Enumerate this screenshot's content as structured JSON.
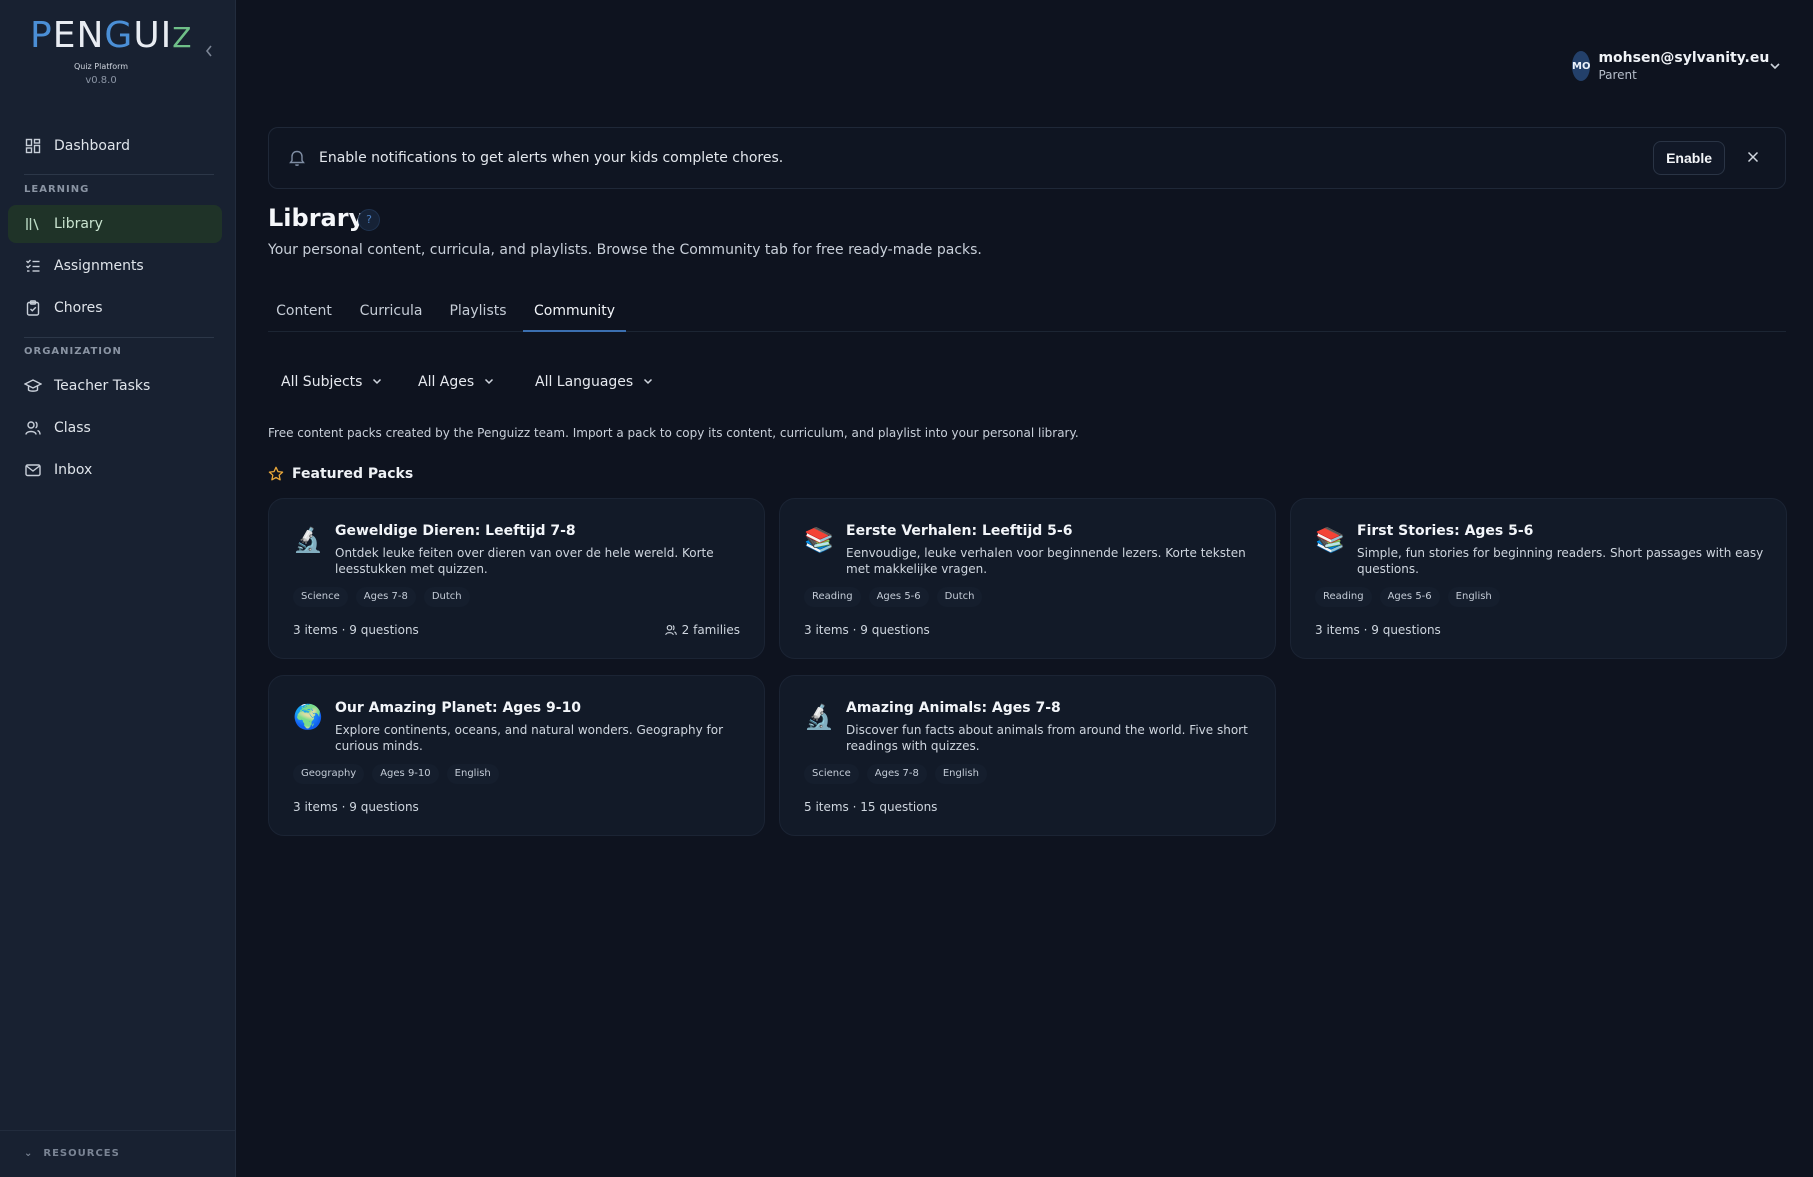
{
  "app": {
    "logo_text_p": "P",
    "logo_text_en": "EN",
    "logo_text_g": "G",
    "logo_text_ui": "UI",
    "logo_text_z": "Z",
    "subtitle": "Quiz Platform",
    "version": "v0.8.0"
  },
  "sidebar": {
    "dashboard": "Dashboard",
    "section_learning": "LEARNING",
    "library": "Library",
    "assignments": "Assignments",
    "chores": "Chores",
    "section_organization": "ORGANIZATION",
    "teacher_tasks": "Teacher Tasks",
    "class": "Class",
    "inbox": "Inbox",
    "resources": "RESOURCES"
  },
  "user": {
    "initials": "MO",
    "email": "mohsen@sylvanity.eu",
    "role": "Parent"
  },
  "banner": {
    "text": "Enable notifications to get alerts when your kids complete chores.",
    "enable_label": "Enable"
  },
  "header": {
    "title": "Library",
    "help": "?",
    "subtitle": "Your personal content, curricula, and playlists. Browse the Community tab for free ready-made packs."
  },
  "tabs": [
    "Content",
    "Curricula",
    "Playlists",
    "Community"
  ],
  "active_tab": "Community",
  "filters": {
    "subjects": "All Subjects",
    "ages": "All Ages",
    "languages": "All Languages"
  },
  "intro": "Free content packs created by the Penguizz team. Import a pack to copy its content, curriculum, and playlist into your personal library.",
  "featured_label": "Featured Packs",
  "packs": [
    {
      "icon": "microscope-icon",
      "emoji": "🔬",
      "title": "Geweldige Dieren: Leeftijd 7-8",
      "desc": "Ontdek leuke feiten over dieren van over de hele wereld. Korte leesstukken met quizzen.",
      "tags": [
        "Science",
        "Ages 7-8",
        "Dutch"
      ],
      "meta": "3 items · 9 questions",
      "families": "2 families"
    },
    {
      "icon": "books-icon",
      "emoji": "📚",
      "title": "Eerste Verhalen: Leeftijd 5-6",
      "desc": "Eenvoudige, leuke verhalen voor beginnende lezers. Korte teksten met makkelijke vragen.",
      "tags": [
        "Reading",
        "Ages 5-6",
        "Dutch"
      ],
      "meta": "3 items · 9 questions"
    },
    {
      "icon": "books-icon",
      "emoji": "📚",
      "title": "First Stories: Ages 5-6",
      "desc": "Simple, fun stories for beginning readers. Short passages with easy questions.",
      "tags": [
        "Reading",
        "Ages 5-6",
        "English"
      ],
      "meta": "3 items · 9 questions"
    },
    {
      "icon": "globe-icon",
      "emoji": "🌍",
      "title": "Our Amazing Planet: Ages 9-10",
      "desc": "Explore continents, oceans, and natural wonders. Geography for curious minds.",
      "tags": [
        "Geography",
        "Ages 9-10",
        "English"
      ],
      "meta": "3 items · 9 questions"
    },
    {
      "icon": "microscope-icon",
      "emoji": "🔬",
      "title": "Amazing Animals: Ages 7-8",
      "desc": "Discover fun facts about animals from around the world. Five short readings with quizzes.",
      "tags": [
        "Science",
        "Ages 7-8",
        "English"
      ],
      "meta": "5 items · 15 questions"
    }
  ]
}
